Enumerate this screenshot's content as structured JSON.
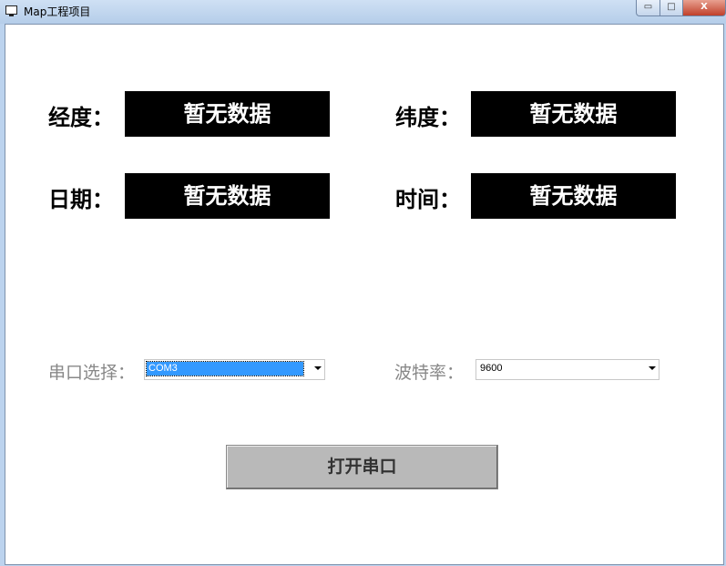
{
  "window": {
    "title": "Map工程项目",
    "minimize": "▭",
    "maximize": "□",
    "close": "X"
  },
  "fields": [
    {
      "label": "经度：",
      "value": "暂无数据"
    },
    {
      "label": "纬度：",
      "value": "暂无数据"
    },
    {
      "label": "日期：",
      "value": "暂无数据"
    },
    {
      "label": "时间：",
      "value": "暂无数据"
    }
  ],
  "serial": {
    "port_label": "串口选择：",
    "port_value": "COM3",
    "baud_label": "波特率：",
    "baud_value": "9600"
  },
  "open_button": "打开串口"
}
